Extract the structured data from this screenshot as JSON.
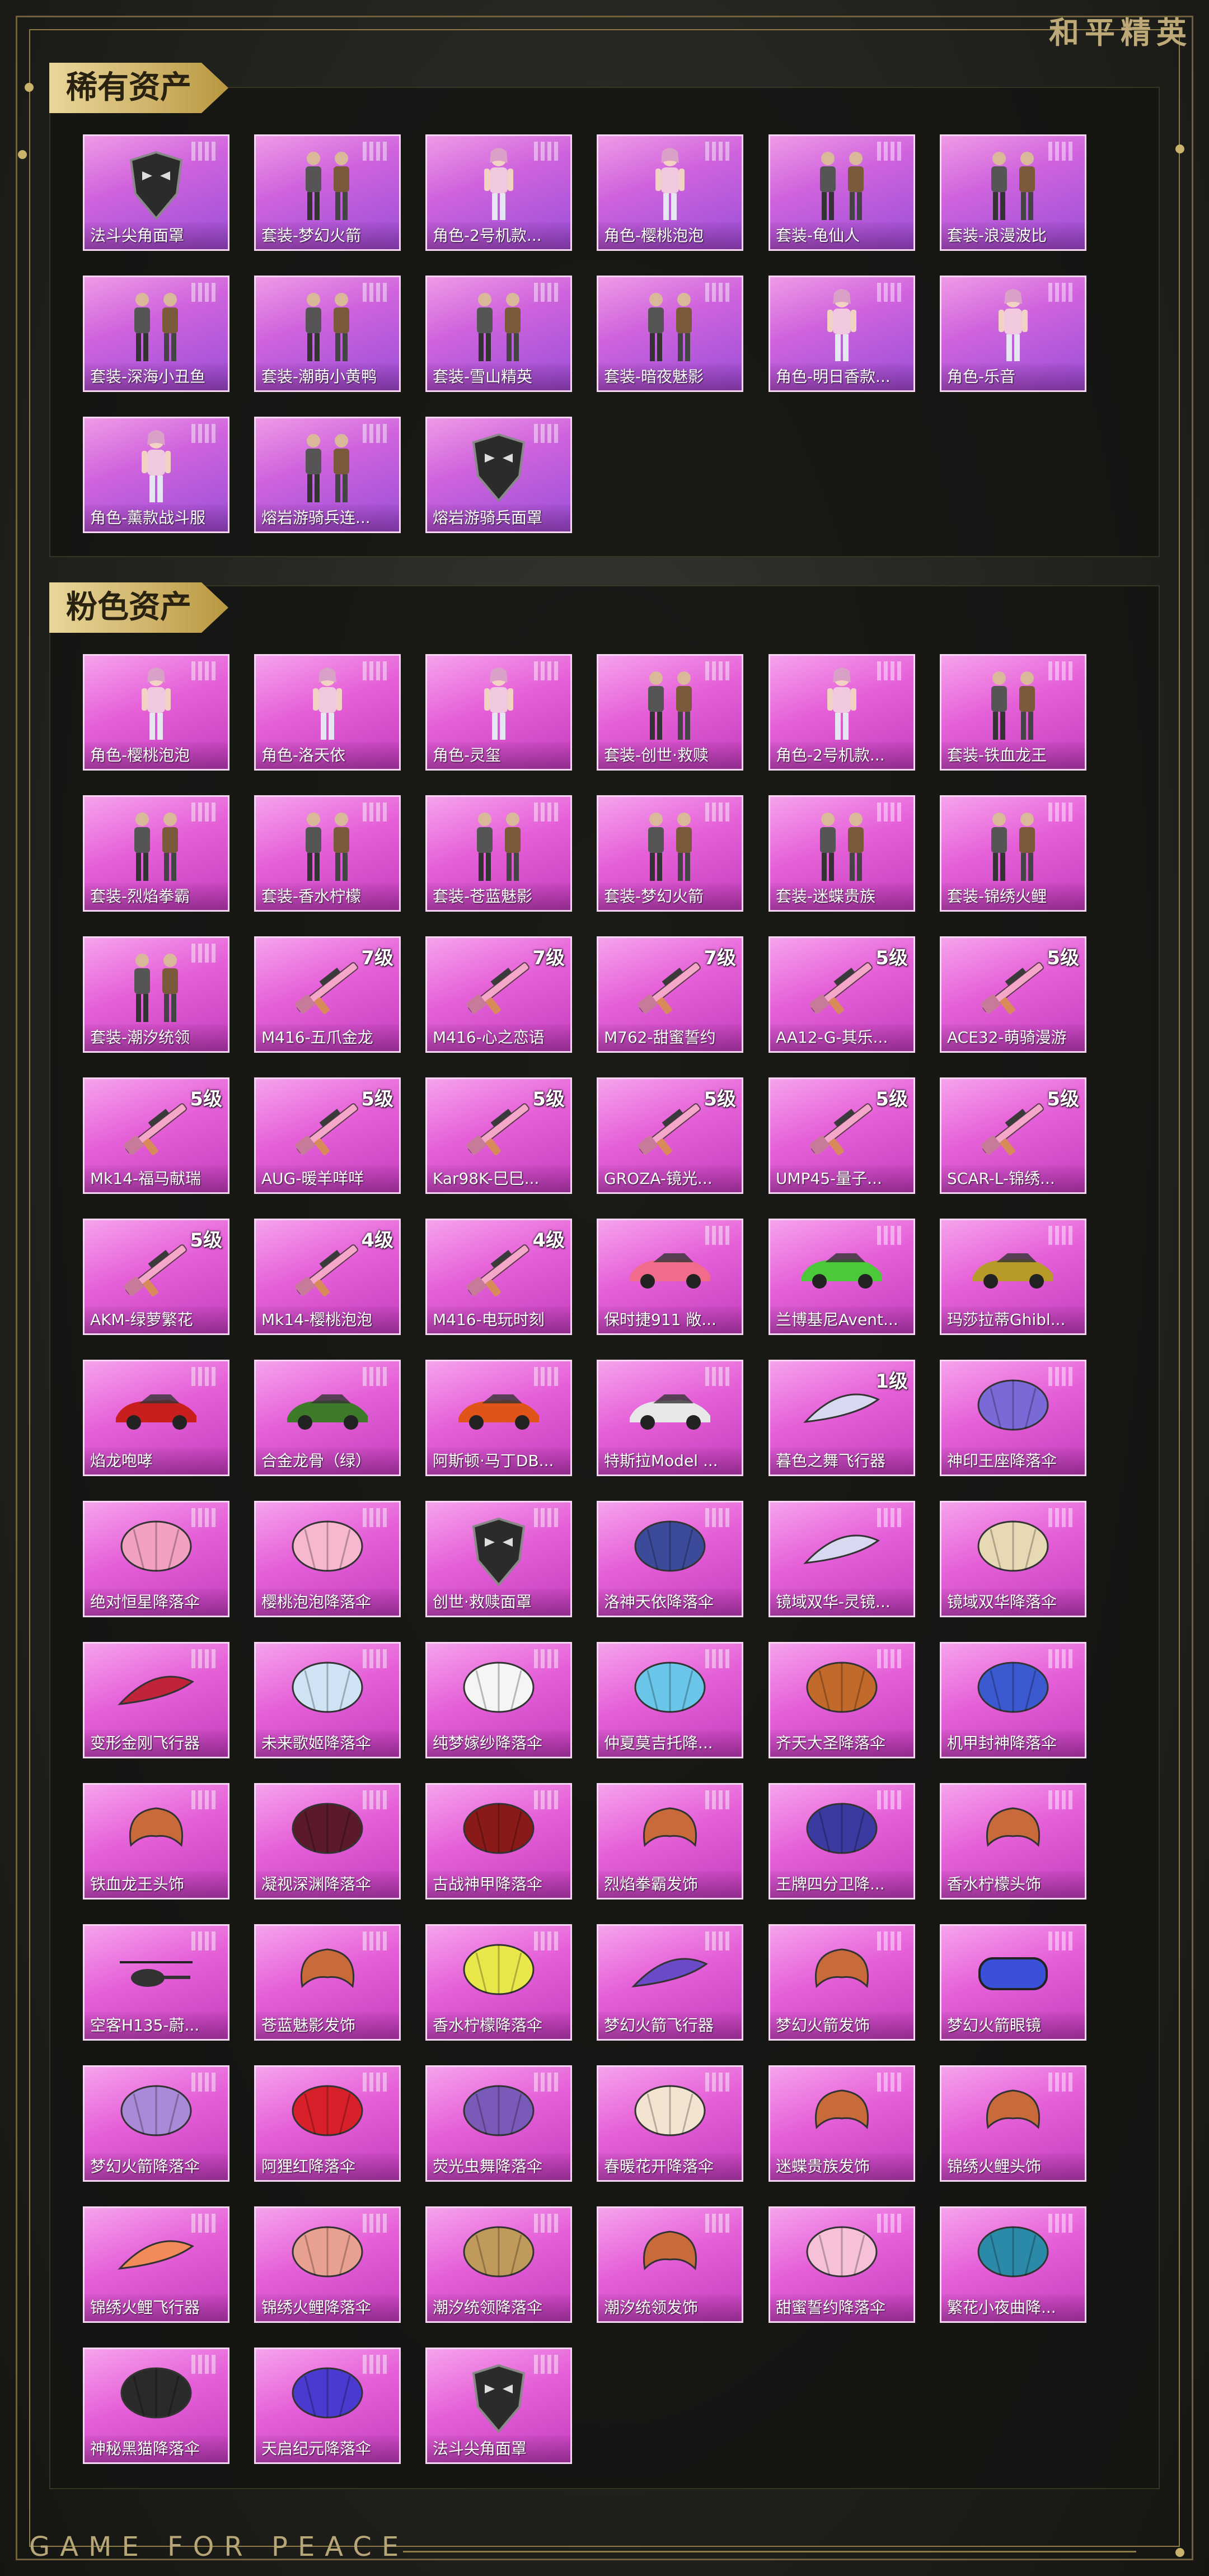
{
  "brand": "和平精英",
  "footer_brand": "GAME FOR PEACE",
  "sections": [
    {
      "title": "稀有资产",
      "rarity": "rare",
      "items": [
        {
          "name": "法斗尖角面罩",
          "icon": "mask-icon"
        },
        {
          "name": "套装-梦幻火箭",
          "icon": "outfit-icon"
        },
        {
          "name": "角色-2号机款...",
          "icon": "character-icon"
        },
        {
          "name": "角色-樱桃泡泡",
          "icon": "character-icon"
        },
        {
          "name": "套装-龟仙人",
          "icon": "outfit-icon"
        },
        {
          "name": "套装-浪漫波比",
          "icon": "outfit-icon"
        },
        {
          "name": "套装-深海小丑鱼",
          "icon": "outfit-icon"
        },
        {
          "name": "套装-潮萌小黄鸭",
          "icon": "outfit-icon"
        },
        {
          "name": "套装-雪山精英",
          "icon": "outfit-icon"
        },
        {
          "name": "套装-暗夜魅影",
          "icon": "outfit-icon"
        },
        {
          "name": "角色-明日香款...",
          "icon": "character-icon"
        },
        {
          "name": "角色-乐音",
          "icon": "character-icon"
        },
        {
          "name": "角色-薰款战斗服",
          "icon": "character-icon"
        },
        {
          "name": "熔岩游骑兵连...",
          "icon": "outfit-icon"
        },
        {
          "name": "熔岩游骑兵面罩",
          "icon": "mask-icon"
        }
      ]
    },
    {
      "title": "粉色资产",
      "rarity": "pink",
      "items": [
        {
          "name": "角色-樱桃泡泡",
          "icon": "character-icon"
        },
        {
          "name": "角色-洛天依",
          "icon": "character-icon"
        },
        {
          "name": "角色-灵玺",
          "icon": "character-icon"
        },
        {
          "name": "套装-创世·救赎",
          "icon": "outfit-icon"
        },
        {
          "name": "角色-2号机款...",
          "icon": "character-icon"
        },
        {
          "name": "套装-铁血龙王",
          "icon": "outfit-icon"
        },
        {
          "name": "套装-烈焰拳霸",
          "icon": "outfit-icon"
        },
        {
          "name": "套装-香水柠檬",
          "icon": "outfit-icon"
        },
        {
          "name": "套装-苍蓝魅影",
          "icon": "outfit-icon"
        },
        {
          "name": "套装-梦幻火箭",
          "icon": "outfit-icon"
        },
        {
          "name": "套装-迷蝶贵族",
          "icon": "outfit-icon"
        },
        {
          "name": "套装-锦绣火鲤",
          "icon": "outfit-icon"
        },
        {
          "name": "套装-潮汐统领",
          "icon": "outfit-icon"
        },
        {
          "name": "M416-五爪金龙",
          "icon": "rifle-icon",
          "level": "7级"
        },
        {
          "name": "M416-心之恋语",
          "icon": "rifle-icon",
          "level": "7级"
        },
        {
          "name": "M762-甜蜜誓约",
          "icon": "rifle-icon",
          "level": "7级"
        },
        {
          "name": "AA12-G-其乐...",
          "icon": "rifle-icon",
          "level": "5级"
        },
        {
          "name": "ACE32-萌骑漫游",
          "icon": "rifle-icon",
          "level": "5级"
        },
        {
          "name": "Mk14-福马献瑞",
          "icon": "rifle-icon",
          "level": "5级"
        },
        {
          "name": "AUG-暖羊咩咩",
          "icon": "rifle-icon",
          "level": "5级"
        },
        {
          "name": "Kar98K-巳巳...",
          "icon": "sniper-icon",
          "level": "5级"
        },
        {
          "name": "GROZA-镜光...",
          "icon": "rifle-icon",
          "level": "5级"
        },
        {
          "name": "UMP45-量子...",
          "icon": "smg-icon",
          "level": "5级"
        },
        {
          "name": "SCAR-L-锦绣...",
          "icon": "rifle-icon",
          "level": "5级"
        },
        {
          "name": "AKM-绿萝繁花",
          "icon": "rifle-icon",
          "level": "5级"
        },
        {
          "name": "Mk14-樱桃泡泡",
          "icon": "rifle-icon",
          "level": "4级"
        },
        {
          "name": "M416-电玩时刻",
          "icon": "rifle-icon",
          "level": "4级"
        },
        {
          "name": "保时捷911 敞...",
          "icon": "car-icon",
          "color": "#f06c8a"
        },
        {
          "name": "兰博基尼Avent...",
          "icon": "car-icon",
          "color": "#4cc83b"
        },
        {
          "name": "玛莎拉蒂Ghibl...",
          "icon": "car-icon",
          "color": "#b89a2a"
        },
        {
          "name": "焰龙咆哮",
          "icon": "car-icon",
          "color": "#c81e1e"
        },
        {
          "name": "合金龙骨（绿）",
          "icon": "car-icon",
          "color": "#3d7a2a"
        },
        {
          "name": "阿斯顿·马丁DB...",
          "icon": "car-icon",
          "color": "#e0541a"
        },
        {
          "name": "特斯拉Model ...",
          "icon": "car-icon",
          "color": "#e8e8e8"
        },
        {
          "name": "暮色之舞飞行器",
          "icon": "glider-icon",
          "level": "1级"
        },
        {
          "name": "神印王座降落伞",
          "icon": "parachute-icon",
          "color": "#7a6ad8"
        },
        {
          "name": "绝对恒星降落伞",
          "icon": "parachute-icon",
          "color": "#f1a0c0"
        },
        {
          "name": "樱桃泡泡降落伞",
          "icon": "parachute-icon",
          "color": "#f7b7cf"
        },
        {
          "name": "创世·救赎面罩",
          "icon": "mask-icon"
        },
        {
          "name": "洛神天依降落伞",
          "icon": "parachute-icon",
          "color": "#3c4a9a"
        },
        {
          "name": "镜域双华-灵镜...",
          "icon": "glider-icon"
        },
        {
          "name": "镜域双华降落伞",
          "icon": "parachute-icon",
          "color": "#e8d9b5"
        },
        {
          "name": "变形金刚飞行器",
          "icon": "glider-icon",
          "color": "#c0233a"
        },
        {
          "name": "未来歌姬降落伞",
          "icon": "parachute-icon",
          "color": "#cfe3f5"
        },
        {
          "name": "纯梦嫁纱降落伞",
          "icon": "parachute-icon",
          "color": "#f5f5f5"
        },
        {
          "name": "仲夏莫吉托降...",
          "icon": "parachute-icon",
          "color": "#6ac6e8"
        },
        {
          "name": "齐天大圣降落伞",
          "icon": "parachute-icon",
          "color": "#c26a2b"
        },
        {
          "name": "机甲封神降落伞",
          "icon": "parachute-icon",
          "color": "#3b5ad0"
        },
        {
          "name": "铁血龙王头饰",
          "icon": "headwear-icon"
        },
        {
          "name": "凝视深渊降落伞",
          "icon": "parachute-icon",
          "color": "#5a1a2a"
        },
        {
          "name": "古战神甲降落伞",
          "icon": "parachute-icon",
          "color": "#8a1a1a"
        },
        {
          "name": "烈焰拳霸发饰",
          "icon": "headwear-icon"
        },
        {
          "name": "王牌四分卫降...",
          "icon": "parachute-icon",
          "color": "#3a3aa0"
        },
        {
          "name": "香水柠檬头饰",
          "icon": "headwear-icon"
        },
        {
          "name": "空客H135-蔚...",
          "icon": "helicopter-icon"
        },
        {
          "name": "苍蓝魅影发饰",
          "icon": "headwear-icon"
        },
        {
          "name": "香水柠檬降落伞",
          "icon": "parachute-icon",
          "color": "#e8e84a"
        },
        {
          "name": "梦幻火箭飞行器",
          "icon": "glider-icon",
          "color": "#6a4ac8"
        },
        {
          "name": "梦幻火箭发饰",
          "icon": "headwear-icon"
        },
        {
          "name": "梦幻火箭眼镜",
          "icon": "goggles-icon"
        },
        {
          "name": "梦幻火箭降落伞",
          "icon": "parachute-icon",
          "color": "#a88ad8"
        },
        {
          "name": "阿狸红降落伞",
          "icon": "parachute-icon",
          "color": "#d8202a"
        },
        {
          "name": "荧光虫舞降落伞",
          "icon": "parachute-icon",
          "color": "#7a5ab8"
        },
        {
          "name": "春暖花开降落伞",
          "icon": "parachute-icon",
          "color": "#f2e4d0"
        },
        {
          "name": "迷蝶贵族发饰",
          "icon": "headwear-icon"
        },
        {
          "name": "锦绣火鲤头饰",
          "icon": "headwear-icon"
        },
        {
          "name": "锦绣火鲤飞行器",
          "icon": "glider-icon",
          "color": "#f28a5a"
        },
        {
          "name": "锦绣火鲤降落伞",
          "icon": "parachute-icon",
          "color": "#e8a090"
        },
        {
          "name": "潮汐统领降落伞",
          "icon": "parachute-icon",
          "color": "#c09a5a"
        },
        {
          "name": "潮汐统领发饰",
          "icon": "headwear-icon"
        },
        {
          "name": "甜蜜誓约降落伞",
          "icon": "parachute-icon",
          "color": "#f5c0d8"
        },
        {
          "name": "繁花小夜曲降...",
          "icon": "parachute-icon",
          "color": "#2a8aa8"
        },
        {
          "name": "神秘黑猫降落伞",
          "icon": "parachute-icon",
          "color": "#2a2a2a"
        },
        {
          "name": "天启纪元降落伞",
          "icon": "parachute-icon",
          "color": "#4a3ad0"
        },
        {
          "name": "法斗尖角面罩",
          "icon": "mask-icon"
        }
      ]
    }
  ]
}
